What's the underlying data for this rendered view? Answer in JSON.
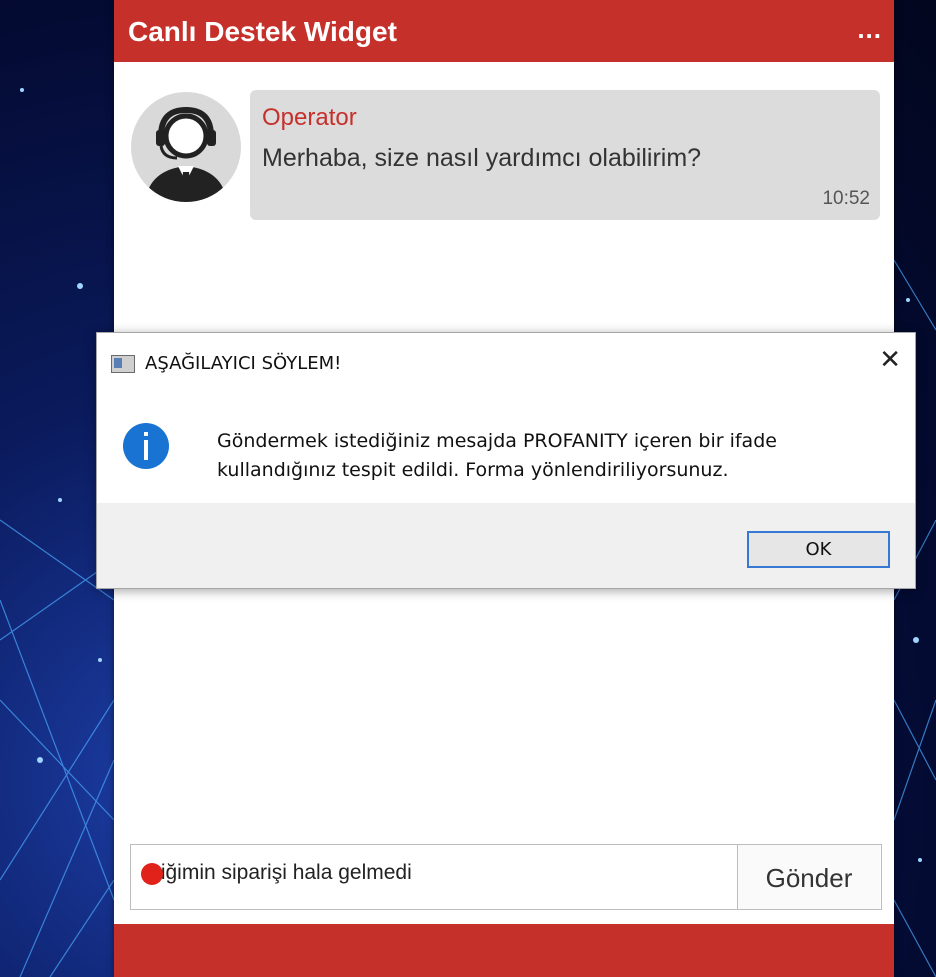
{
  "widget": {
    "title": "Canlı Destek Widget",
    "menu_label": "...",
    "brand_color": "#c6302b"
  },
  "message": {
    "sender": "Operator",
    "text": "Merhaba, size nasıl yardımcı olabilirim?",
    "time": "10:52",
    "avatar_icon": "support-agent-avatar"
  },
  "input": {
    "value": "tiğimin siparişi hala gelmedi",
    "send_label": "Gönder"
  },
  "dialog": {
    "title": "AŞAĞILAYICI SÖYLEM!",
    "close_label": "✕",
    "message": "Göndermek istediğiniz mesajda PROFANITY içeren bir ifade kullandığınız tespit edildi. Forma yönlendiriliyorsunuz.",
    "ok_label": "OK",
    "icon": "info-icon"
  }
}
